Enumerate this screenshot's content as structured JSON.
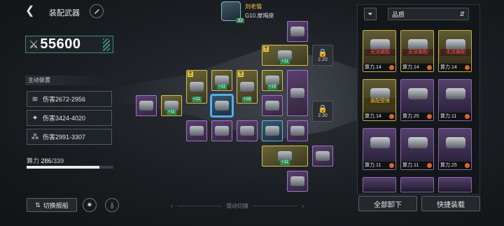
{
  "header": {
    "title": "装配武器",
    "player_name": "刘老猫",
    "player_ship": "G10.摩羯座",
    "player_level": "32"
  },
  "power": {
    "value": "55600"
  },
  "active": {
    "label": "主动装置",
    "weapons": [
      {
        "damage": "伤害2672-2956",
        "icon": "claw-icon"
      },
      {
        "damage": "伤害3424-4020",
        "icon": "spark-icon"
      },
      {
        "damage": "伤害2991-3307",
        "icon": "laser-icon"
      }
    ]
  },
  "energy": {
    "label": "算力",
    "current": "286",
    "max": "/339",
    "fraction": 0.84
  },
  "footer": {
    "switch_ship": "切换舰船",
    "swipe_hint": "滑动切换"
  },
  "grid": {
    "main_badge": "主",
    "plus_label": "+11",
    "plus_18": "+18",
    "plus_13": "+13",
    "lock_a": "2.20",
    "lock_b": "2.30"
  },
  "panel": {
    "sort_label": "品质",
    "cards": [
      {
        "status": "无法装配",
        "power": "算力.14"
      },
      {
        "status": "无法装配",
        "power": "算力.14"
      },
      {
        "status": "无法装配",
        "power": "算力.14"
      },
      {
        "status": "装配受限",
        "power": "算力.14"
      },
      {
        "status": "",
        "power": "算力.25"
      },
      {
        "status": "",
        "power": "算力.11"
      },
      {
        "status": "",
        "power": "算力.11"
      },
      {
        "status": "",
        "power": "算力.11"
      },
      {
        "status": "",
        "power": "算力.25"
      }
    ],
    "clear_all": "全部卸下",
    "quick_equip": "快捷装载"
  }
}
